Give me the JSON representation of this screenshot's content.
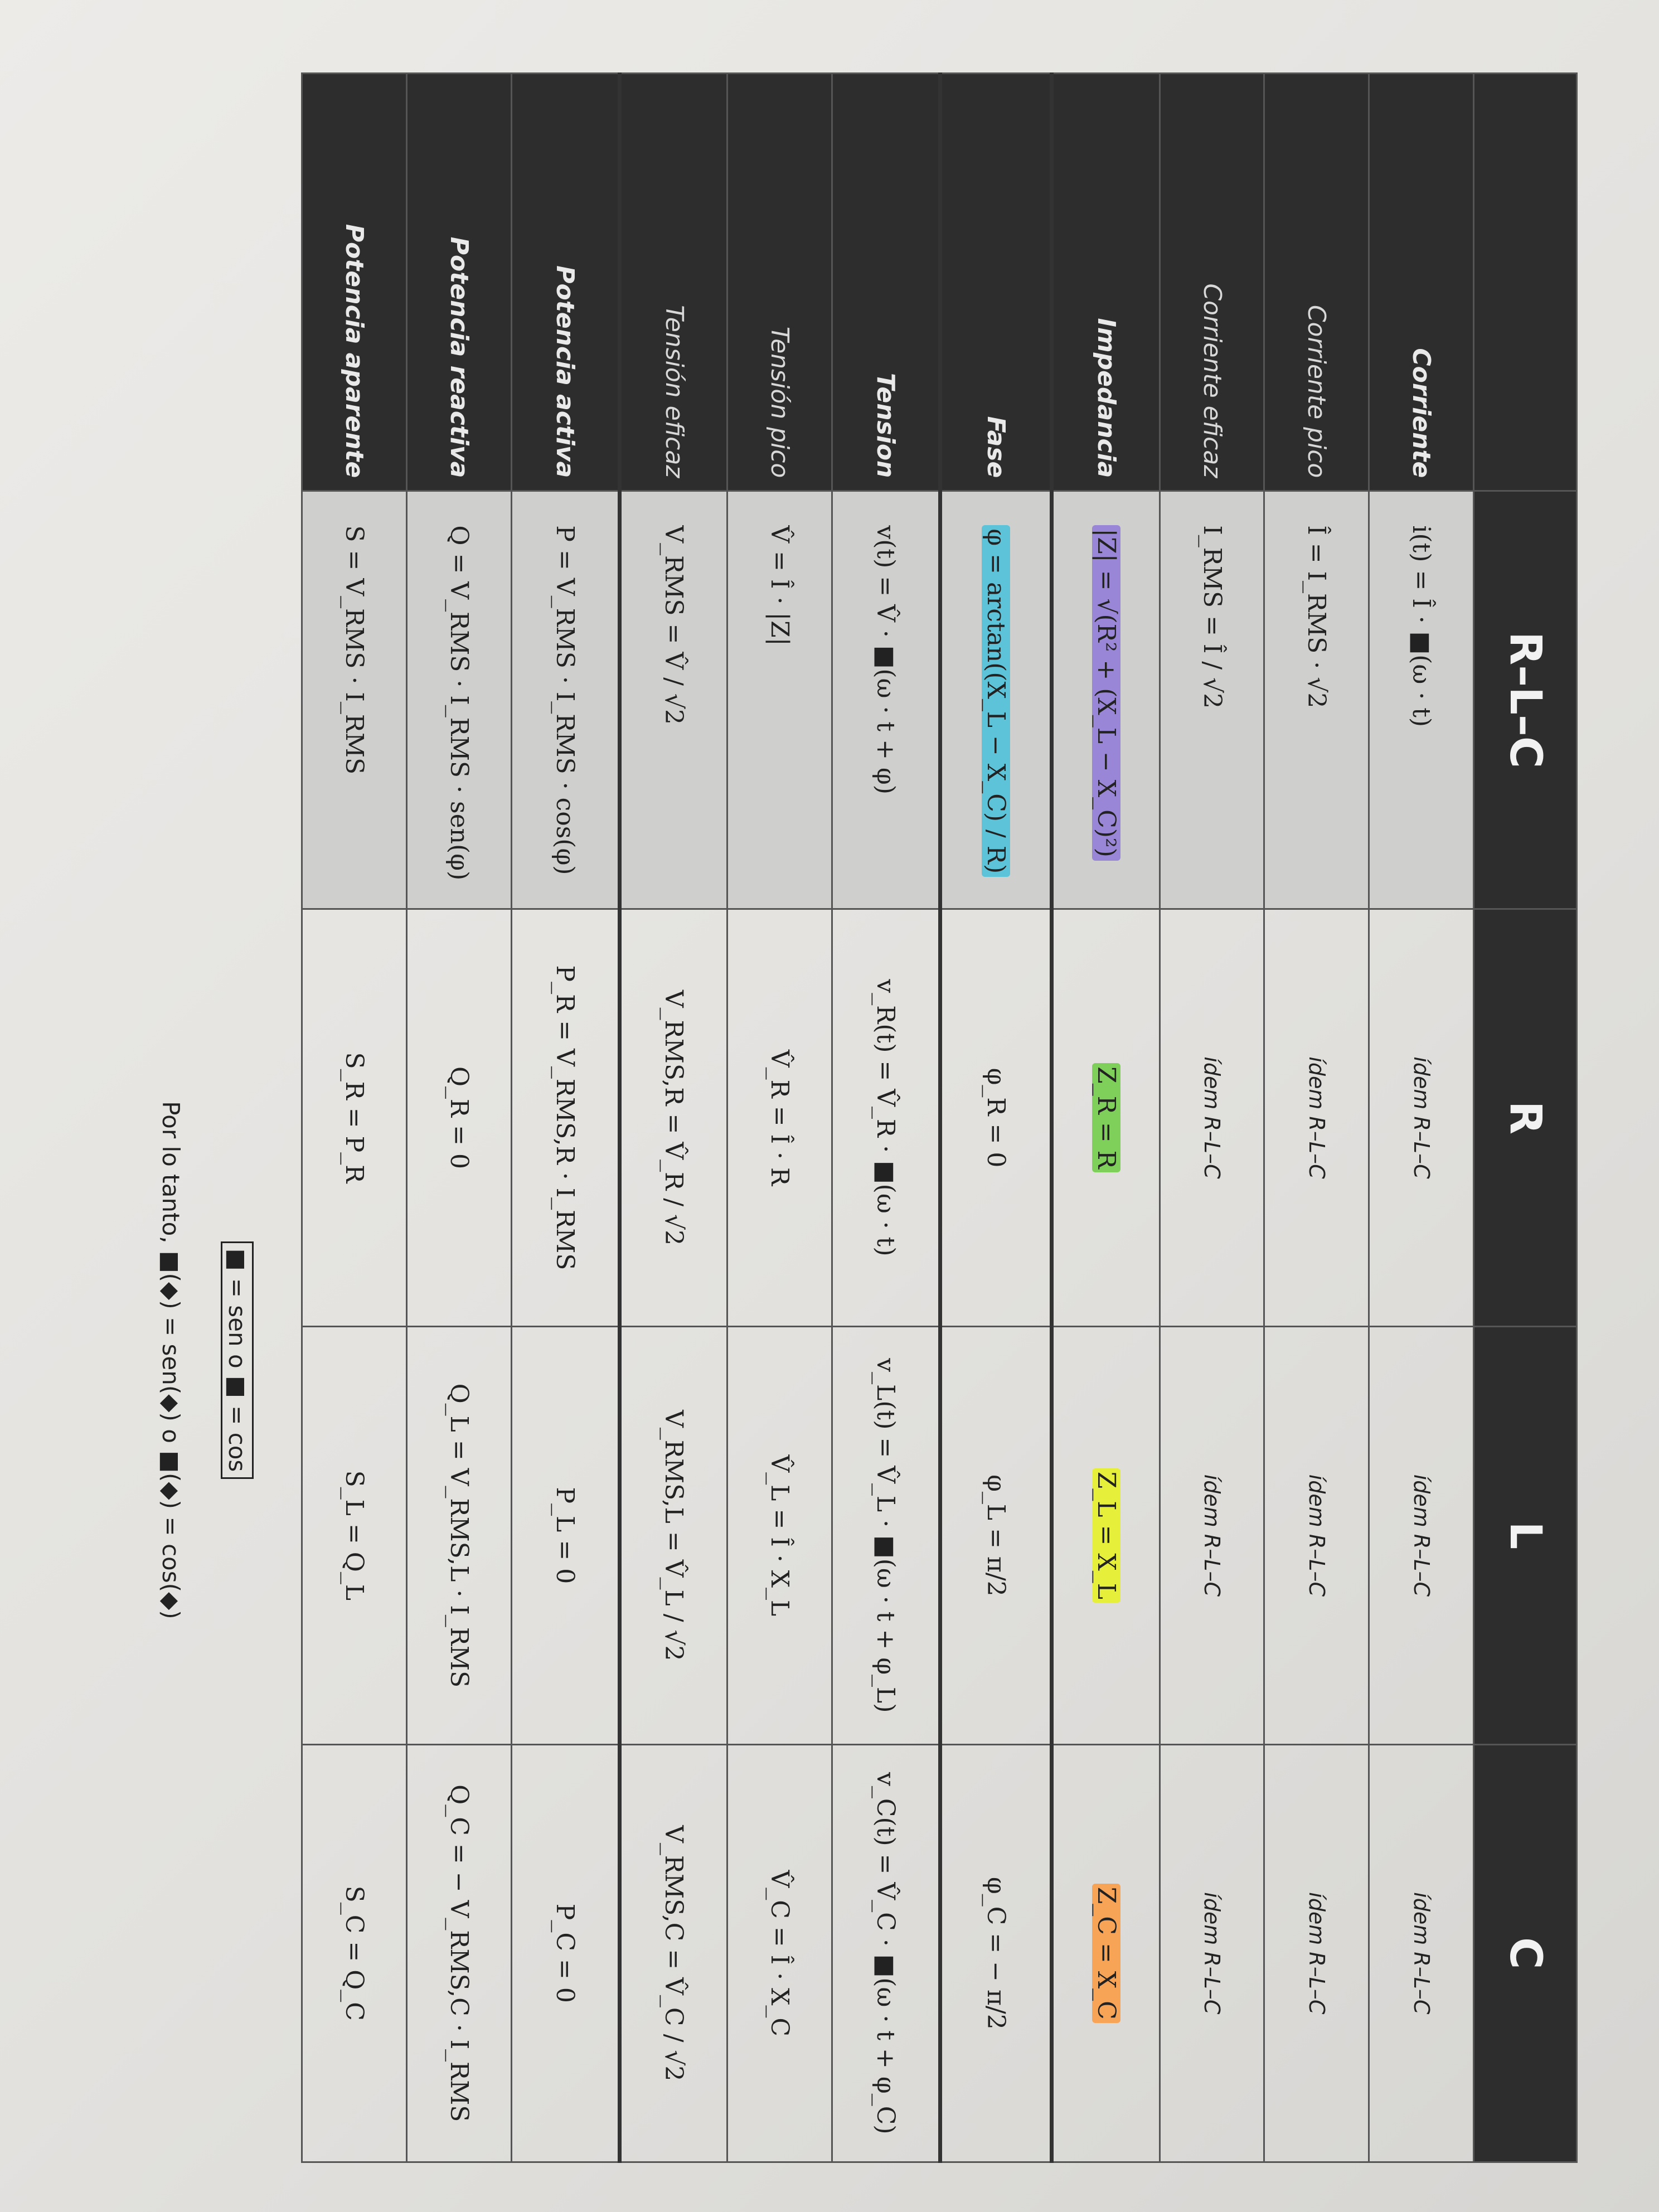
{
  "table": {
    "columns": [
      "R–L–C",
      "R",
      "L",
      "C"
    ],
    "rows": [
      {
        "label": "Corriente",
        "cells": [
          "i(t) = Î · ■(ω · t)",
          "ídem R–L–C",
          "ídem R–L–C",
          "ídem R–L–C"
        ]
      },
      {
        "label": "Corriente pico",
        "cells": [
          "Î = I_RMS · √2",
          "ídem R–L–C",
          "ídem R–L–C",
          "ídem R–L–C"
        ]
      },
      {
        "label": "Corriente eficaz",
        "cells": [
          "I_RMS = Î / √2",
          "ídem R–L–C",
          "ídem R–L–C",
          "ídem R–L–C"
        ]
      },
      {
        "label": "Impedancia",
        "cells": [
          "|Z| = √(R² + (X_L − X_C)²)",
          "Z_R = R",
          "Z_L = X_L",
          "Z_C = X_C"
        ]
      },
      {
        "label": "Fase",
        "cells": [
          "φ = arctan((X_L − X_C) / R)",
          "φ_R = 0",
          "φ_L = π/2",
          "φ_C = − π/2"
        ]
      },
      {
        "label": "Tension",
        "cells": [
          "v(t) = V̂ · ■(ω · t + φ)",
          "v_R(t) = V̂_R · ■(ω · t)",
          "v_L(t) = V̂_L · ■(ω · t + φ_L)",
          "v_C(t) = V̂_C · ■(ω · t + φ_C)"
        ]
      },
      {
        "label": "Tensión pico",
        "cells": [
          "V̂ = Î · |Z|",
          "V̂_R = Î · R",
          "V̂_L = Î · X_L",
          "V̂_C = Î · X_C"
        ]
      },
      {
        "label": "Tensión eficaz",
        "cells": [
          "V_RMS = V̂ / √2",
          "V_RMS,R = V̂_R / √2",
          "V_RMS,L = V̂_L / √2",
          "V_RMS,C = V̂_C / √2"
        ]
      },
      {
        "label": "Potencia activa",
        "cells": [
          "P = V_RMS · I_RMS · cos(φ)",
          "P_R = V_RMS,R · I_RMS",
          "P_L = 0",
          "P_C = 0"
        ]
      },
      {
        "label": "Potencia reactiva",
        "cells": [
          "Q = V_RMS · I_RMS · sen(φ)",
          "Q_R = 0",
          "Q_L = V_RMS,L · I_RMS",
          "Q_C = − V_RMS,C · I_RMS"
        ]
      },
      {
        "label": "Potencia aparente",
        "cells": [
          "S = V_RMS · I_RMS",
          "S_R = P_R",
          "S_L = Q_L",
          "S_C = Q_C"
        ]
      }
    ]
  },
  "notes": {
    "legend": "■ = sen o ■ = cos",
    "conclusion": "Por lo tanto, ■(◆) = sen(◆) o ■(◆) = cos(◆)"
  },
  "highlight_colors": {
    "omega": "#f57fb6",
    "Z": "#9a86d6",
    "R": "#7fd05a",
    "XL": "#e6ef3a",
    "XC": "#f8a457",
    "phi": "#5cc3d8"
  }
}
